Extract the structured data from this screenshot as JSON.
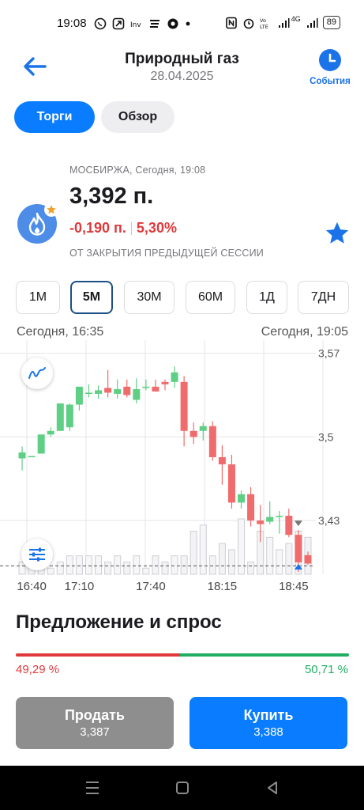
{
  "status_bar": {
    "time": "19:08",
    "icons": [
      "whatsapp-icon",
      "telegram-icon",
      "investing-icon",
      "ticker-icon",
      "chrome-icon",
      "dot-icon"
    ],
    "right_icons": [
      "nfc-icon",
      "alarm-icon",
      "volte-icon",
      "signal-icon",
      "signal-icon"
    ],
    "network": "4G",
    "battery": "89"
  },
  "header": {
    "title": "Природный газ",
    "date": "28.04.2025",
    "events_label": "События"
  },
  "tabs": [
    {
      "label": "Торги",
      "active": true
    },
    {
      "label": "Обзор",
      "active": false
    }
  ],
  "instrument": {
    "exchange_line": "МОСБИРЖА, Сегодня, 19:08",
    "price": "3,392 п.",
    "change_abs": "-0,190 п.",
    "change_pct": "5,30%",
    "subtitle": "ОТ ЗАКРЫТИЯ ПРЕДЫДУЩЕЙ СЕССИИ",
    "logo_icon": "flame-icon",
    "favorite_icon": "star-icon"
  },
  "intervals": [
    {
      "label": "1М",
      "active": false
    },
    {
      "label": "5М",
      "active": true
    },
    {
      "label": "30М",
      "active": false
    },
    {
      "label": "60М",
      "active": false
    },
    {
      "label": "1Д",
      "active": false
    },
    {
      "label": "7ДН",
      "active": false
    }
  ],
  "range": {
    "from": "Сегодня, 16:35",
    "to": "Сегодня, 19:05"
  },
  "colors": {
    "accent": "#0a7cff",
    "up": "#5fcf85",
    "down": "#f06b6b",
    "sell": "#e0393b",
    "buy": "#1fae62"
  },
  "chart_data": {
    "type": "candlestick",
    "y_ticks": [
      "3,57",
      "3,5",
      "3,43"
    ],
    "y_tick_values": [
      3.57,
      3.5,
      3.43
    ],
    "ylim": [
      3.385,
      3.577
    ],
    "x_ticks": [
      "16:40",
      "17:10",
      "17:40",
      "18:15",
      "18:45"
    ],
    "x_tick_index": [
      1,
      3,
      6,
      9,
      12
    ],
    "reference_price": 3.392,
    "candles": [
      {
        "o": 3.482,
        "h": 3.492,
        "l": 3.472,
        "c": 3.487
      },
      {
        "o": 3.484,
        "h": 3.484,
        "l": 3.484,
        "c": 3.484
      },
      {
        "o": 3.486,
        "h": 3.502,
        "l": 3.486,
        "c": 3.502
      },
      {
        "o": 3.502,
        "h": 3.508,
        "l": 3.5,
        "c": 3.505
      },
      {
        "o": 3.505,
        "h": 3.528,
        "l": 3.505,
        "c": 3.528
      },
      {
        "o": 3.508,
        "h": 3.528,
        "l": 3.505,
        "c": 3.527
      },
      {
        "o": 3.527,
        "h": 3.542,
        "l": 3.522,
        "c": 3.542
      },
      {
        "o": 3.537,
        "h": 3.544,
        "l": 3.533,
        "c": 3.537
      },
      {
        "o": 3.536,
        "h": 3.543,
        "l": 3.532,
        "c": 3.539
      },
      {
        "o": 3.541,
        "h": 3.556,
        "l": 3.533,
        "c": 3.537
      },
      {
        "o": 3.536,
        "h": 3.548,
        "l": 3.532,
        "c": 3.54
      },
      {
        "o": 3.542,
        "h": 3.548,
        "l": 3.533,
        "c": 3.535
      },
      {
        "o": 3.531,
        "h": 3.549,
        "l": 3.528,
        "c": 3.54
      },
      {
        "o": 3.542,
        "h": 3.548,
        "l": 3.539,
        "c": 3.542
      },
      {
        "o": 3.542,
        "h": 3.548,
        "l": 3.538,
        "c": 3.538
      },
      {
        "o": 3.546,
        "h": 3.548,
        "l": 3.539,
        "c": 3.544
      },
      {
        "o": 3.546,
        "h": 3.559,
        "l": 3.541,
        "c": 3.554
      },
      {
        "o": 3.546,
        "h": 3.551,
        "l": 3.492,
        "c": 3.505
      },
      {
        "o": 3.505,
        "h": 3.512,
        "l": 3.494,
        "c": 3.5
      },
      {
        "o": 3.505,
        "h": 3.512,
        "l": 3.497,
        "c": 3.509
      },
      {
        "o": 3.509,
        "h": 3.513,
        "l": 3.48,
        "c": 3.483
      },
      {
        "o": 3.483,
        "h": 3.493,
        "l": 3.46,
        "c": 3.477
      },
      {
        "o": 3.477,
        "h": 3.485,
        "l": 3.44,
        "c": 3.445
      },
      {
        "o": 3.445,
        "h": 3.455,
        "l": 3.44,
        "c": 3.452
      },
      {
        "o": 3.452,
        "h": 3.458,
        "l": 3.425,
        "c": 3.43
      },
      {
        "o": 3.43,
        "h": 3.443,
        "l": 3.412,
        "c": 3.427
      },
      {
        "o": 3.429,
        "h": 3.446,
        "l": 3.427,
        "c": 3.433
      },
      {
        "o": 3.434,
        "h": 3.438,
        "l": 3.419,
        "c": 3.434
      },
      {
        "o": 3.434,
        "h": 3.44,
        "l": 3.416,
        "c": 3.418
      },
      {
        "o": 3.418,
        "h": 3.422,
        "l": 3.387,
        "c": 3.395
      },
      {
        "o": 3.401,
        "h": 3.404,
        "l": 3.393,
        "c": 3.394
      }
    ],
    "volumes": [
      2,
      3,
      2,
      1,
      2,
      3,
      3,
      3,
      3,
      2,
      3,
      2,
      3,
      1,
      3,
      2,
      3,
      3,
      7,
      8,
      3,
      5,
      4,
      9,
      2,
      7,
      6,
      4,
      5,
      7,
      6
    ]
  },
  "depth": {
    "title": "Предложение и спрос",
    "sell_pct": "49,29 %",
    "buy_pct": "50,71 %",
    "sell_value": 49.29
  },
  "actions": {
    "sell_label": "Продать",
    "sell_price": "3,387",
    "buy_label": "Купить",
    "buy_price": "3,388"
  },
  "nav": {
    "icons": [
      "recents-icon",
      "home-icon",
      "back-nav-icon"
    ]
  }
}
